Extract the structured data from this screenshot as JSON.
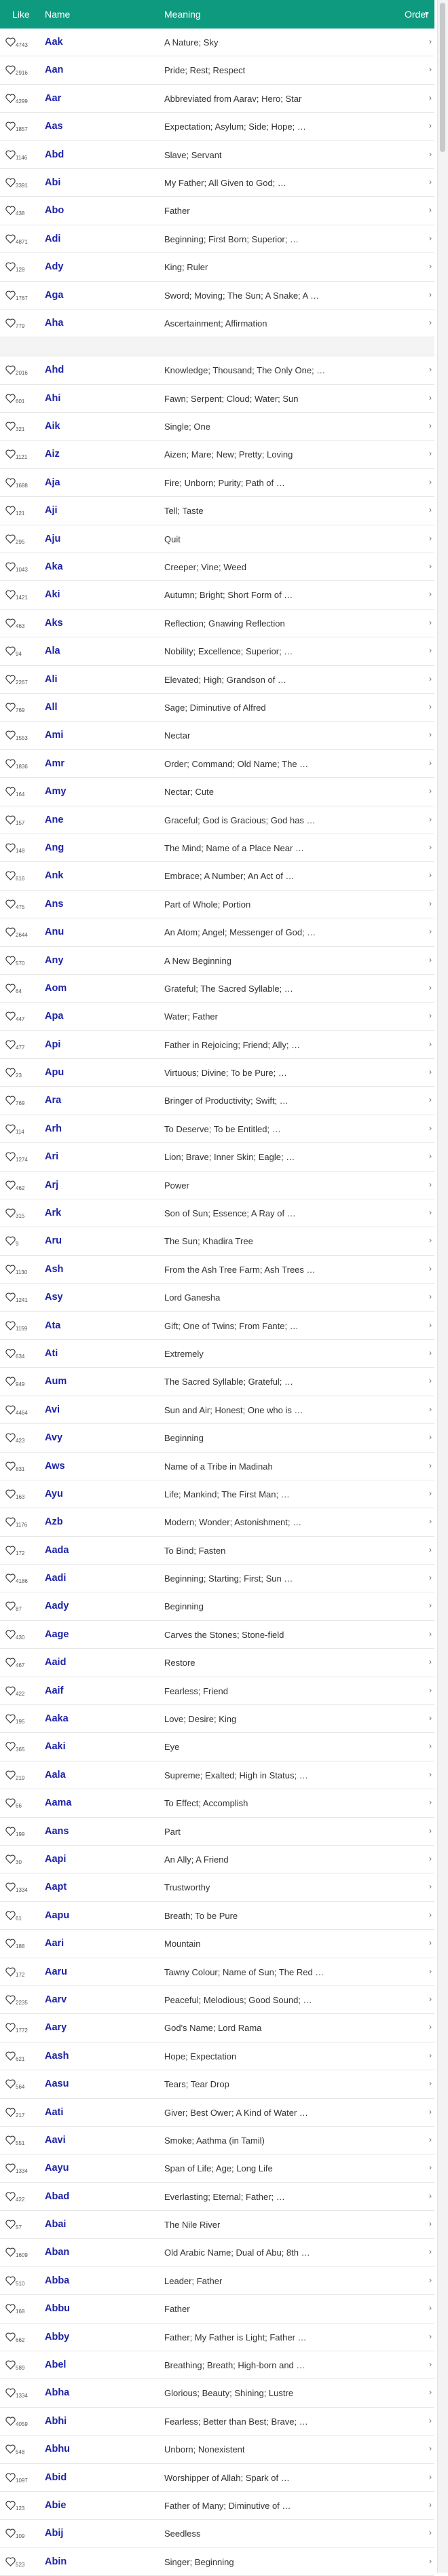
{
  "header": {
    "like": "Like",
    "name": "Name",
    "meaning": "Meaning",
    "order": "Order",
    "order_icon": "▾"
  },
  "colors": {
    "header_bg": "#0e9a7e",
    "name_text": "#1d23a8"
  },
  "rows": [
    {
      "count": "4743",
      "name": "Aak",
      "meaning": "A Nature; Sky"
    },
    {
      "count": "2916",
      "name": "Aan",
      "meaning": "Pride; Rest; Respect"
    },
    {
      "count": "4299",
      "name": "Aar",
      "meaning": "Abbreviated from Aarav; Hero; Star"
    },
    {
      "count": "1857",
      "name": "Aas",
      "meaning": "Expectation; Asylum; Side; Hope; …"
    },
    {
      "count": "1146",
      "name": "Abd",
      "meaning": "Slave; Servant"
    },
    {
      "count": "3391",
      "name": "Abi",
      "meaning": "My Father; All Given to God; …"
    },
    {
      "count": "438",
      "name": "Abo",
      "meaning": "Father"
    },
    {
      "count": "4871",
      "name": "Adi",
      "meaning": "Beginning; First Born; Superior; …"
    },
    {
      "count": "128",
      "name": "Ady",
      "meaning": "King; Ruler"
    },
    {
      "count": "1767",
      "name": "Aga",
      "meaning": "Sword; Moving; The Sun; A Snake; A …"
    },
    {
      "count": "779",
      "name": "Aha",
      "meaning": "Ascertainment; Affirmation"
    },
    {
      "gap": true
    },
    {
      "count": "2016",
      "name": "Ahd",
      "meaning": "Knowledge; Thousand; The Only One; …"
    },
    {
      "count": "601",
      "name": "Ahi",
      "meaning": "Fawn; Serpent; Cloud; Water; Sun"
    },
    {
      "count": "321",
      "name": "Aik",
      "meaning": "Single; One"
    },
    {
      "count": "1121",
      "name": "Aiz",
      "meaning": "Aizen; Mare; New; Pretty; Loving"
    },
    {
      "count": "1688",
      "name": "Aja",
      "meaning": "Fire; Unborn; Purity; Path of …"
    },
    {
      "count": "121",
      "name": "Aji",
      "meaning": "Tell; Taste"
    },
    {
      "count": "295",
      "name": "Aju",
      "meaning": "Quit"
    },
    {
      "count": "1043",
      "name": "Aka",
      "meaning": "Creeper; Vine; Weed"
    },
    {
      "count": "1421",
      "name": "Aki",
      "meaning": "Autumn; Bright; Short Form of …"
    },
    {
      "count": "463",
      "name": "Aks",
      "meaning": "Reflection; Gnawing Reflection"
    },
    {
      "count": "94",
      "name": "Ala",
      "meaning": "Nobility; Excellence; Superior; …"
    },
    {
      "count": "2267",
      "name": "Ali",
      "meaning": "Elevated; High; Grandson of …"
    },
    {
      "count": "769",
      "name": "All",
      "meaning": "Sage; Diminutive of Alfred"
    },
    {
      "count": "1553",
      "name": "Ami",
      "meaning": "Nectar"
    },
    {
      "count": "1836",
      "name": "Amr",
      "meaning": "Order; Command; Old Name; The …"
    },
    {
      "count": "164",
      "name": "Amy",
      "meaning": "Nectar; Cute"
    },
    {
      "count": "157",
      "name": "Ane",
      "meaning": "Graceful; God is Gracious; God has …"
    },
    {
      "count": "148",
      "name": "Ang",
      "meaning": "The Mind; Name of a Place Near …"
    },
    {
      "count": "616",
      "name": "Ank",
      "meaning": "Embrace; A Number; An Act of …"
    },
    {
      "count": "475",
      "name": "Ans",
      "meaning": "Part of Whole; Portion"
    },
    {
      "count": "2644",
      "name": "Anu",
      "meaning": "An Atom; Angel; Messenger of God; …"
    },
    {
      "count": "570",
      "name": "Any",
      "meaning": "A New Beginning"
    },
    {
      "count": "64",
      "name": "Aom",
      "meaning": "Grateful; The Sacred Syllable; …"
    },
    {
      "count": "447",
      "name": "Apa",
      "meaning": "Water; Father"
    },
    {
      "count": "477",
      "name": "Api",
      "meaning": "Father in Rejoicing; Friend; Ally; …"
    },
    {
      "count": "23",
      "name": "Apu",
      "meaning": "Virtuous; Divine; To be Pure; …"
    },
    {
      "count": "769",
      "name": "Ara",
      "meaning": "Bringer of Productivity; Swift; …"
    },
    {
      "count": "114",
      "name": "Arh",
      "meaning": "To Deserve; To be Entitled; …"
    },
    {
      "count": "1274",
      "name": "Ari",
      "meaning": "Lion; Brave; Inner Skin; Eagle; …"
    },
    {
      "count": "462",
      "name": "Arj",
      "meaning": "Power"
    },
    {
      "count": "315",
      "name": "Ark",
      "meaning": "Son of Sun; Essence; A Ray of …"
    },
    {
      "count": "9",
      "name": "Aru",
      "meaning": "The Sun; Khadira Tree"
    },
    {
      "count": "1130",
      "name": "Ash",
      "meaning": "From the Ash Tree Farm; Ash Trees …"
    },
    {
      "count": "1241",
      "name": "Asy",
      "meaning": "Lord Ganesha"
    },
    {
      "count": "1159",
      "name": "Ata",
      "meaning": "Gift; One of Twins; From Fante; …"
    },
    {
      "count": "634",
      "name": "Ati",
      "meaning": "Extremely"
    },
    {
      "count": "949",
      "name": "Aum",
      "meaning": "The Sacred Syllable; Grateful; …"
    },
    {
      "count": "4464",
      "name": "Avi",
      "meaning": "Sun and Air; Honest; One who is …"
    },
    {
      "count": "423",
      "name": "Avy",
      "meaning": "Beginning"
    },
    {
      "count": "831",
      "name": "Aws",
      "meaning": "Name of a Tribe in Madinah"
    },
    {
      "count": "163",
      "name": "Ayu",
      "meaning": "Life; Mankind; The First Man; …"
    },
    {
      "count": "1176",
      "name": "Azb",
      "meaning": "Modern; Wonder; Astonishment; …"
    },
    {
      "count": "172",
      "name": "Aada",
      "meaning": "To Bind; Fasten"
    },
    {
      "count": "4186",
      "name": "Aadi",
      "meaning": "Beginning; Starting; First; Sun …"
    },
    {
      "count": "87",
      "name": "Aady",
      "meaning": "Beginning"
    },
    {
      "count": "430",
      "name": "Aage",
      "meaning": "Carves the Stones; Stone-field"
    },
    {
      "count": "467",
      "name": "Aaid",
      "meaning": "Restore"
    },
    {
      "count": "422",
      "name": "Aaif",
      "meaning": "Fearless; Friend"
    },
    {
      "count": "195",
      "name": "Aaka",
      "meaning": "Love; Desire; King"
    },
    {
      "count": "365",
      "name": "Aaki",
      "meaning": "Eye"
    },
    {
      "count": "219",
      "name": "Aala",
      "meaning": "Supreme; Exalted; High in Status; …"
    },
    {
      "count": "66",
      "name": "Aama",
      "meaning": "To Effect; Accomplish"
    },
    {
      "count": "199",
      "name": "Aans",
      "meaning": "Part"
    },
    {
      "count": "30",
      "name": "Aapi",
      "meaning": "An Ally; A Friend"
    },
    {
      "count": "1334",
      "name": "Aapt",
      "meaning": "Trustworthy"
    },
    {
      "count": "61",
      "name": "Aapu",
      "meaning": "Breath; To be Pure"
    },
    {
      "count": "188",
      "name": "Aari",
      "meaning": "Mountain"
    },
    {
      "count": "172",
      "name": "Aaru",
      "meaning": "Tawny Colour; Name of Sun; The Red …"
    },
    {
      "count": "2235",
      "name": "Aarv",
      "meaning": "Peaceful; Melodious; Good Sound; …"
    },
    {
      "count": "1772",
      "name": "Aary",
      "meaning": "God's Name; Lord Rama"
    },
    {
      "count": "621",
      "name": "Aash",
      "meaning": "Hope; Expectation"
    },
    {
      "count": "564",
      "name": "Aasu",
      "meaning": "Tears; Tear Drop"
    },
    {
      "count": "217",
      "name": "Aati",
      "meaning": "Giver; Best Ower; A Kind of Water …"
    },
    {
      "count": "551",
      "name": "Aavi",
      "meaning": "Smoke; Aathma (in Tamil)"
    },
    {
      "count": "1334",
      "name": "Aayu",
      "meaning": "Span of Life; Age; Long Life"
    },
    {
      "count": "422",
      "name": "Abad",
      "meaning": "Everlasting; Eternal; Father; …"
    },
    {
      "count": "57",
      "name": "Abai",
      "meaning": "The Nile River"
    },
    {
      "count": "1609",
      "name": "Aban",
      "meaning": "Old Arabic Name; Dual of Abu; 8th …"
    },
    {
      "count": "510",
      "name": "Abba",
      "meaning": "Leader; Father"
    },
    {
      "count": "168",
      "name": "Abbu",
      "meaning": "Father"
    },
    {
      "count": "662",
      "name": "Abby",
      "meaning": "Father; My Father is Light; Father …"
    },
    {
      "count": "589",
      "name": "Abel",
      "meaning": "Breathing; Breath; High-born and …"
    },
    {
      "count": "1334",
      "name": "Abha",
      "meaning": "Glorious; Beauty; Shining; Lustre"
    },
    {
      "count": "4059",
      "name": "Abhi",
      "meaning": "Fearless; Better than Best; Brave; …"
    },
    {
      "count": "548",
      "name": "Abhu",
      "meaning": "Unborn; Nonexistent"
    },
    {
      "count": "1097",
      "name": "Abid",
      "meaning": "Worshipper of Allah; Spark of …"
    },
    {
      "count": "123",
      "name": "Abie",
      "meaning": "Father of Many; Diminutive of …"
    },
    {
      "count": "109",
      "name": "Abij",
      "meaning": "Seedless"
    },
    {
      "count": "523",
      "name": "Abin",
      "meaning": "Singer; Beginning"
    }
  ]
}
